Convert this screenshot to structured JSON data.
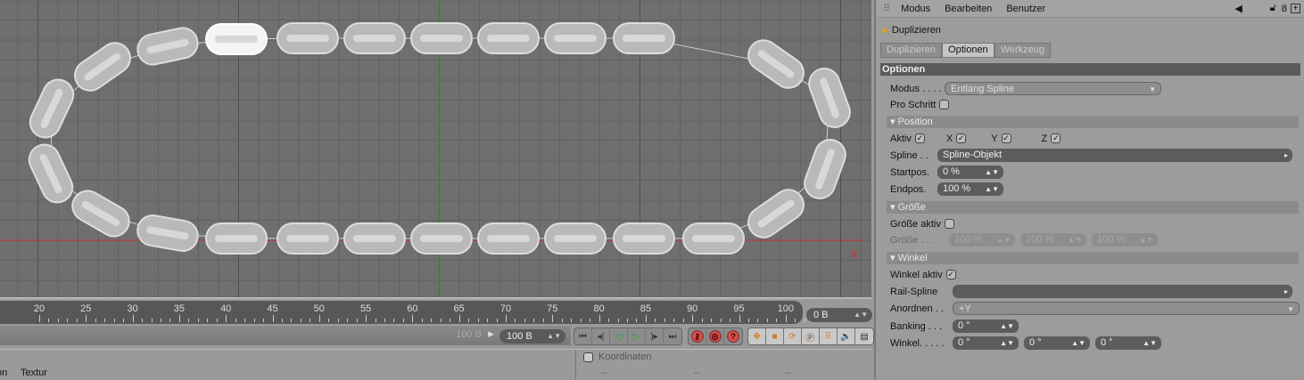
{
  "viewport": {
    "axis_label": "X",
    "colors": {
      "x_axis": "#c0332f",
      "y_axis": "#2f9a3a"
    }
  },
  "timeline": {
    "ticks": [
      "20",
      "25",
      "30",
      "35",
      "40",
      "45",
      "50",
      "55",
      "60",
      "65",
      "70",
      "75",
      "80",
      "85",
      "90",
      "95",
      "100"
    ],
    "current_frame": "0 B",
    "range_end_small": "100 B",
    "range_end": "100 B"
  },
  "transport": {
    "buttons": [
      "go-start",
      "prev-key",
      "play-backward",
      "play-forward",
      "next-key",
      "go-end"
    ]
  },
  "bottom": {
    "tab_partial": "on",
    "tab_texture": "Textur",
    "coords_title": "Koordinaten",
    "coord_values": [
      "--",
      "--",
      "--"
    ]
  },
  "panel": {
    "menu": [
      "Modus",
      "Bearbeiten",
      "Benutzer"
    ],
    "object_title": "Duplizieren",
    "tabs": [
      "Duplizieren",
      "Optionen",
      "Werkzeug"
    ],
    "section_title": "Optionen",
    "modus_label": "Modus . . . .",
    "modus_value": "Entlang Spline",
    "pro_schritt": "Pro Schritt",
    "position": {
      "title": "Position",
      "aktiv": "Aktiv",
      "x": "X",
      "y": "Y",
      "z": "Z",
      "spline_label": "Spline . .",
      "spline_value": "Spline-Objekt",
      "start_label": "Startpos.",
      "start_value": "0 %",
      "end_label": "Endpos.",
      "end_value": "100 %"
    },
    "size": {
      "title": "Größe",
      "aktiv": "Größe aktiv",
      "label": "Größe . . . .",
      "values": [
        "100 %",
        "100 %",
        "100 %"
      ]
    },
    "angle": {
      "title": "Winkel",
      "aktiv": "Winkel aktiv",
      "rail_label": "Rail-Spline",
      "anordnen_label": "Anordnen . .",
      "anordnen_value": "+Y",
      "banking_label": "Banking . . .",
      "banking_value": "0 °",
      "winkel_label": "Winkel. . . . .",
      "winkel_values": [
        "0 °",
        "0 °",
        "0 °"
      ]
    }
  }
}
